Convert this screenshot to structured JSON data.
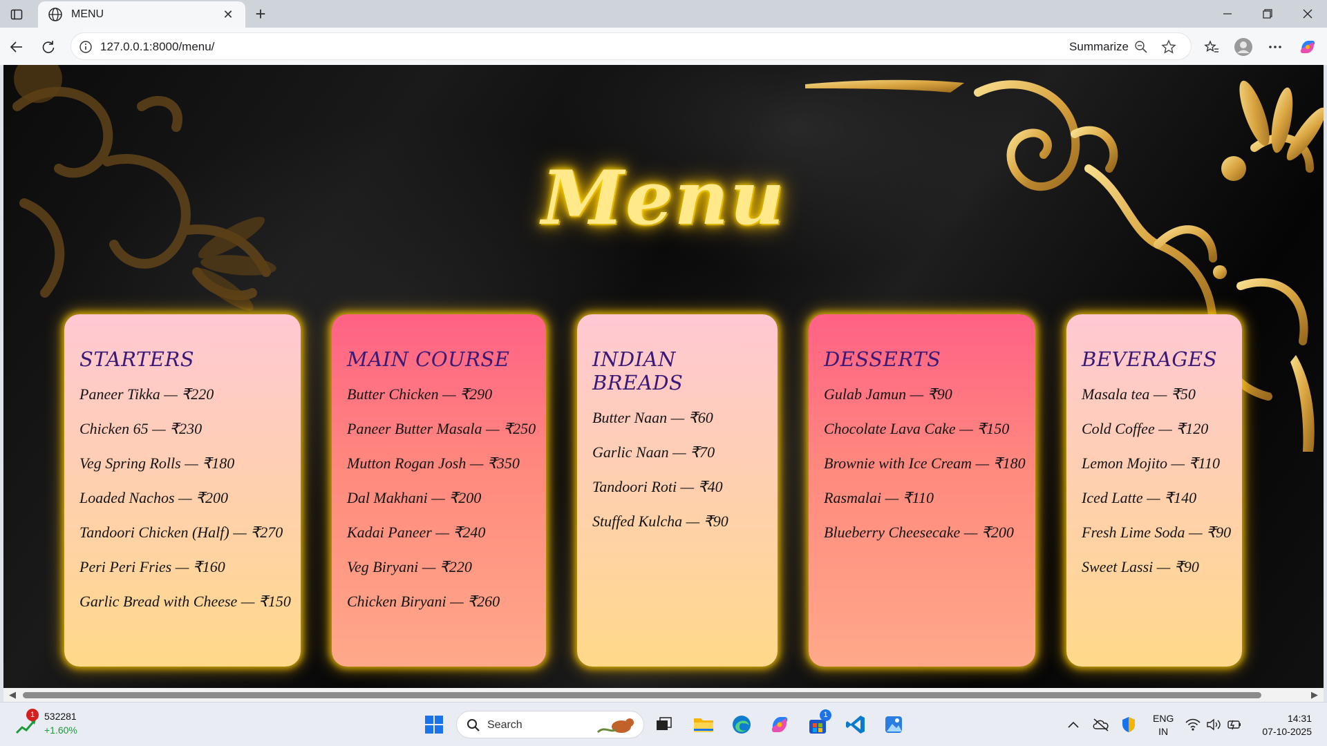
{
  "browser": {
    "tab_title": "MENU",
    "url": "127.0.0.1:8000/menu/",
    "summarize_label": "Summarize",
    "new_tab_symbol": "+",
    "close_tab_symbol": "✕"
  },
  "page": {
    "heading": "Menu",
    "categories": [
      {
        "title": "STARTERS",
        "theme": "light",
        "items": [
          "Paneer Tikka — ₹220",
          "Chicken 65 — ₹230",
          "Veg Spring Rolls — ₹180",
          "Loaded Nachos — ₹200",
          "Tandoori Chicken (Half) — ₹270",
          "Peri Peri Fries — ₹160",
          "Garlic Bread with Cheese — ₹150"
        ]
      },
      {
        "title": "MAIN COURSE",
        "theme": "hot",
        "items": [
          "Butter Chicken — ₹290",
          "Paneer Butter Masala — ₹250",
          "Mutton Rogan Josh — ₹350",
          "Dal Makhani — ₹200",
          "Kadai Paneer — ₹240",
          "Veg Biryani — ₹220",
          "Chicken Biryani — ₹260"
        ]
      },
      {
        "title": "INDIAN BREADS",
        "theme": "light",
        "items": [
          "Butter Naan — ₹60",
          "Garlic Naan — ₹70",
          "Tandoori Roti — ₹40",
          "Stuffed Kulcha — ₹90"
        ]
      },
      {
        "title": "DESSERTS",
        "theme": "hot",
        "items": [
          "Gulab Jamun — ₹90",
          "Chocolate Lava Cake — ₹150",
          "Brownie with Ice Cream — ₹180",
          "Rasmalai — ₹110",
          "Blueberry Cheesecake — ₹200"
        ]
      },
      {
        "title": "BEVERAGES",
        "theme": "light",
        "items": [
          "Masala tea — ₹50",
          "Cold Coffee — ₹120",
          "Lemon Mojito — ₹110",
          "Iced Latte — ₹140",
          "Fresh Lime Soda — ₹90",
          "Sweet Lassi — ₹90"
        ]
      }
    ]
  },
  "taskbar": {
    "stock_value": "532281",
    "stock_change": "+1.60%",
    "stock_badge": "1",
    "search_label": "Search",
    "store_badge": "1",
    "lang_top": "ENG",
    "lang_bottom": "IN",
    "time": "14:31",
    "date": "07-10-2025"
  },
  "colors": {
    "gold": "#e9b94a",
    "title_glow": "#ffd400",
    "heading_purple": "#3a1a78",
    "card_light": "#ffd98a",
    "card_hot": "#ff6185"
  }
}
